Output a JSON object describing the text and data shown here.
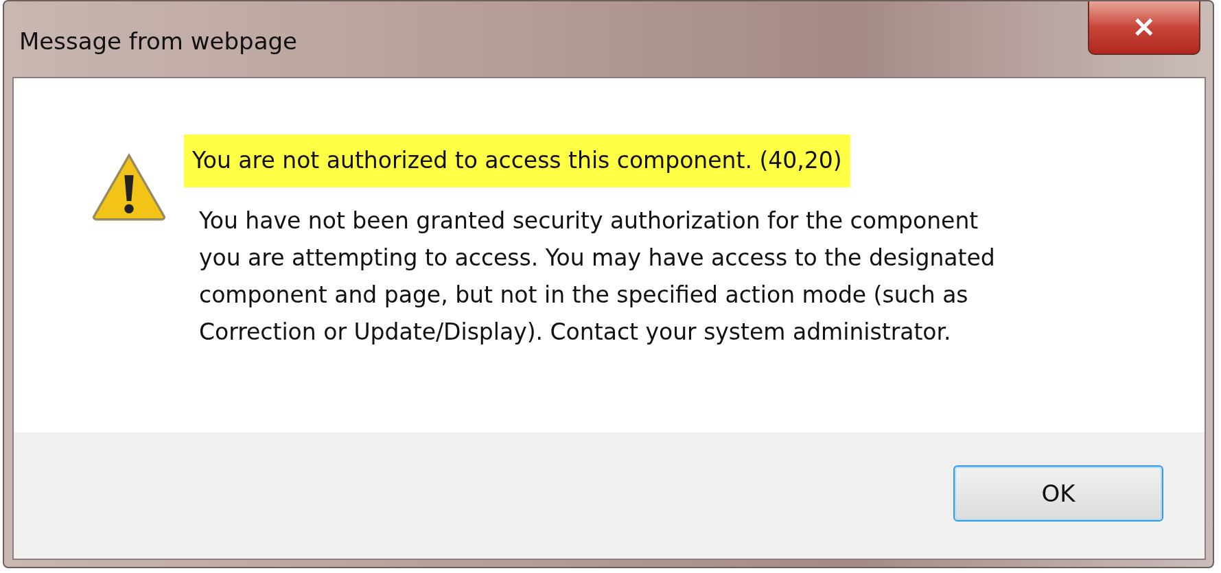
{
  "window": {
    "title": "Message from webpage",
    "close_label": "✕"
  },
  "message": {
    "heading": "You are not authorized to access this component. (40,20)",
    "heading_highlighted": true,
    "lines": [
      "You have not been granted security authorization for the component",
      "you are attempting to access. You may have access to the designated",
      "component and page, but not in the specified action mode (such as",
      "Correction or Update/Display).  Contact your system administrator."
    ]
  },
  "buttons": [
    {
      "label": "OK",
      "selected": true
    }
  ]
}
